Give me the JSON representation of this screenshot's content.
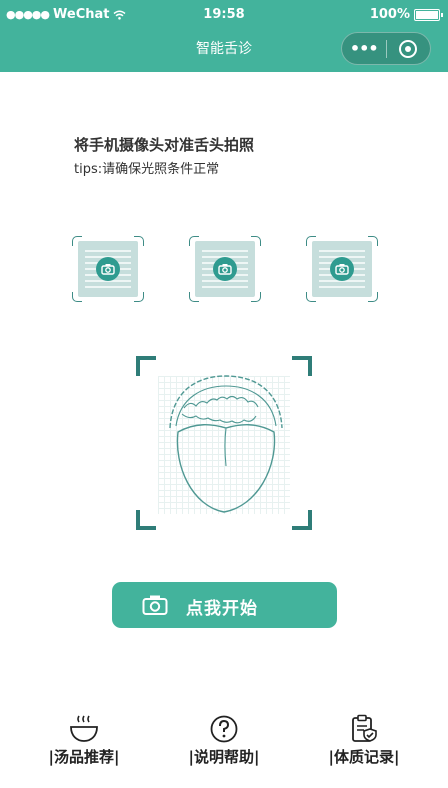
{
  "status_bar": {
    "signal": "●●●●●",
    "carrier": "WeChat",
    "time": "19:58",
    "battery": "100%"
  },
  "nav": {
    "title": "智能舌诊",
    "more_label": "•••"
  },
  "content": {
    "instruction": "将手机摄像头对准舌头拍照",
    "tips": "tips:请确保光照条件正常"
  },
  "start_button": {
    "label": "点我开始",
    "icon": "camera-icon"
  },
  "tabbar": {
    "items": [
      {
        "label": "|汤品推荐|",
        "icon": "soup-bowl-icon"
      },
      {
        "label": "|说明帮助|",
        "icon": "help-icon"
      },
      {
        "label": "|体质记录|",
        "icon": "clipboard-check-icon"
      }
    ]
  },
  "colors": {
    "brand": "#43b39c",
    "accent_dark": "#2f7d78",
    "sample_card": "#c6dedc"
  }
}
